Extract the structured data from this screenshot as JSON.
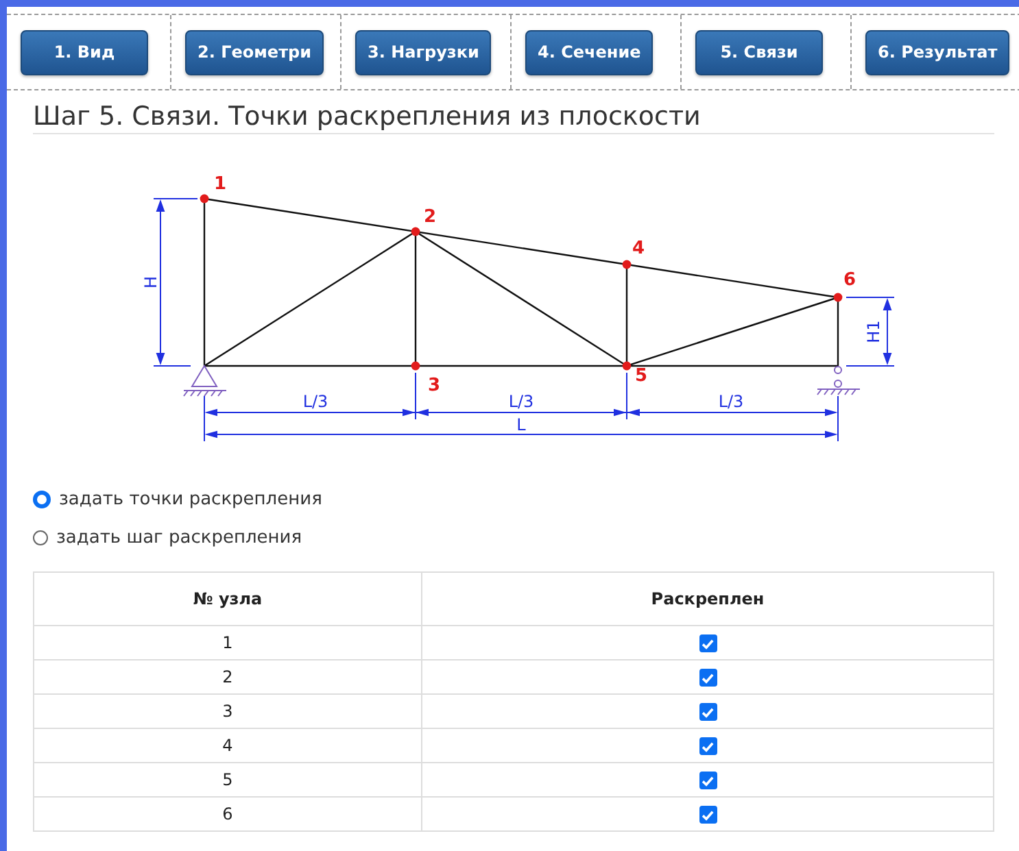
{
  "tabs": [
    {
      "label": "1. Вид"
    },
    {
      "label": "2. Геометри"
    },
    {
      "label": "3. Нагрузки"
    },
    {
      "label": "4. Сечение"
    },
    {
      "label": "5. Связи"
    },
    {
      "label": "6. Результат"
    }
  ],
  "heading": "Шаг 5. Связи. Точки раскрепления из плоскости",
  "diagram": {
    "node_labels": [
      "1",
      "2",
      "3",
      "4",
      "5",
      "6"
    ],
    "height_label": "H",
    "end_height_label": "H1",
    "panel_labels": [
      "L/3",
      "L/3",
      "L/3"
    ],
    "span_label": "L"
  },
  "options": [
    {
      "label": "задать точки раскрепления",
      "selected": true
    },
    {
      "label": "задать шаг раскрепления",
      "selected": false
    }
  ],
  "table": {
    "columns": [
      "№ узла",
      "Раскреплен"
    ],
    "rows": [
      {
        "node": "1",
        "checked": true
      },
      {
        "node": "2",
        "checked": true
      },
      {
        "node": "3",
        "checked": true
      },
      {
        "node": "4",
        "checked": true
      },
      {
        "node": "5",
        "checked": true
      },
      {
        "node": "6",
        "checked": true
      }
    ]
  }
}
